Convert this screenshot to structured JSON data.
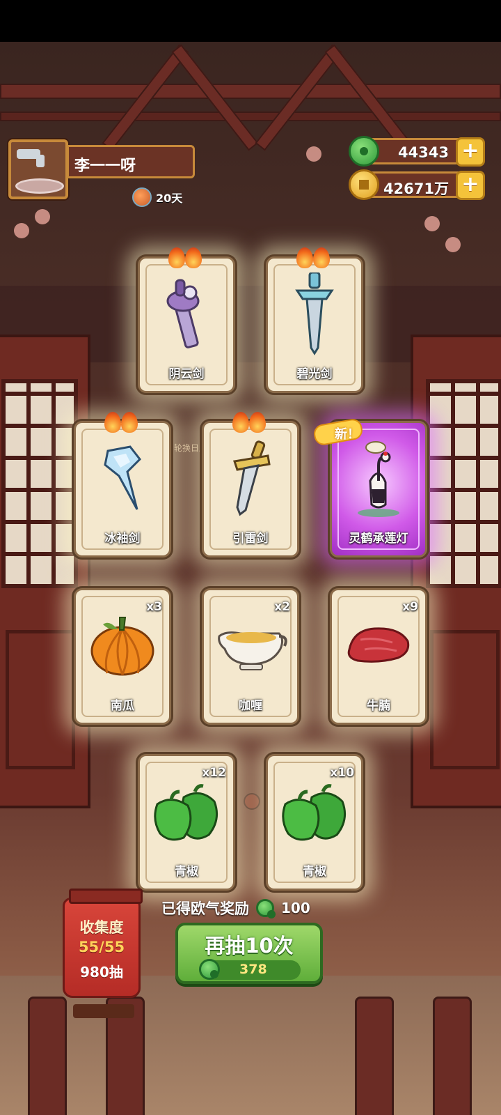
{
  "player": {
    "name": "李一一呀",
    "days": "20天"
  },
  "currencies": {
    "jade": {
      "value": "44343",
      "icon": "jade-coin-icon"
    },
    "gold": {
      "value": "42671万",
      "icon": "gold-coin-icon"
    },
    "plus_label": "+"
  },
  "background": {
    "calendar_label": "轮换日历"
  },
  "cards": [
    {
      "name": "阴云剑",
      "flames": true,
      "icon": "purple-sword-icon"
    },
    {
      "name": "碧光剑",
      "flames": true,
      "icon": "blue-sword-icon"
    },
    {
      "name": "冰袖剑",
      "flames": true,
      "icon": "ice-sword-icon"
    },
    {
      "name": "引雷剑",
      "flames": true,
      "icon": "golden-sword-icon"
    },
    {
      "name": "灵鹤承莲灯",
      "new": true,
      "new_label": "新！",
      "icon": "crane-lotus-lamp-icon"
    },
    {
      "name": "南瓜",
      "qty": "x3",
      "icon": "pumpkin-icon"
    },
    {
      "name": "咖喱",
      "qty": "x2",
      "icon": "curry-gravy-boat-icon"
    },
    {
      "name": "牛腩",
      "qty": "x9",
      "icon": "beef-icon"
    },
    {
      "name": "青椒",
      "qty": "x12",
      "icon": "green-pepper-icon"
    },
    {
      "name": "青椒",
      "qty": "x10",
      "icon": "green-pepper-icon"
    }
  ],
  "reward": {
    "label": "已得欧气奖励",
    "value": "100"
  },
  "draw_button": {
    "label": "再抽10次",
    "cost": "378"
  },
  "collection": {
    "title": "收集度",
    "progress": "55/55",
    "draws": "980抽"
  },
  "colors": {
    "accent_green": "#5fae3a",
    "accent_gold": "#f4c33a",
    "card_bg": "#f4e8ce",
    "new_purple": "#d05ae8"
  }
}
